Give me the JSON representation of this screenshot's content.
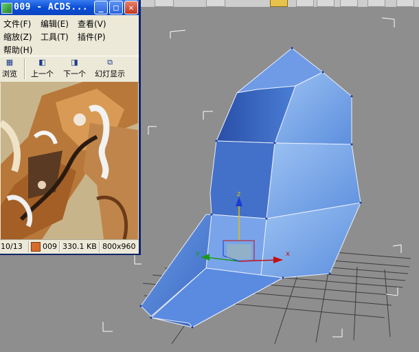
{
  "acdsee": {
    "title": "009 - ACDS...",
    "controls": {
      "minimize": "_",
      "maximize": "□",
      "close": "✕"
    },
    "menu": [
      "文件(F)",
      "编辑(E)",
      "查看(V)",
      "缩放(Z)",
      "工具(T)",
      "插件(P)",
      "帮助(H)"
    ],
    "toolbar": {
      "browse": "浏览",
      "prev": "上一个",
      "next": "下一个",
      "slideshow": "幻灯显示"
    },
    "status": {
      "index": "10/13",
      "name": "009",
      "size": "330.1 KB",
      "dimensions": "800x960"
    }
  },
  "viewport": {
    "gizmo": {
      "z_label": "z",
      "x_label": "x",
      "y_label": "y"
    }
  },
  "colors": {
    "viewport_bg": "#8e8e8e",
    "mesh_blue": "#4a7ed4",
    "title_blue": "#0b4fd6"
  }
}
